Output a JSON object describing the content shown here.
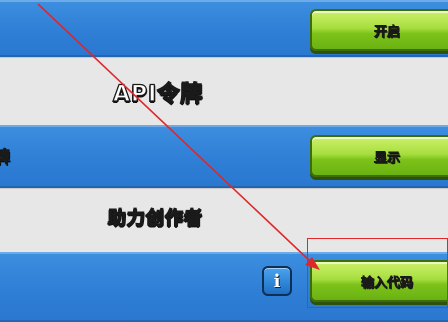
{
  "rows": {
    "api_title": "API令牌",
    "token_cut_label": "牌",
    "help_title": "助力创作者"
  },
  "buttons": {
    "open": "开启",
    "show": "显示",
    "enter_code": "输入代码"
  },
  "icons": {
    "info": "i"
  },
  "colors": {
    "blue_row": "#2f7fd6",
    "grey_row": "#e7e7e7",
    "button_green": "#8bd02c",
    "annotation_red": "#e0262a"
  }
}
